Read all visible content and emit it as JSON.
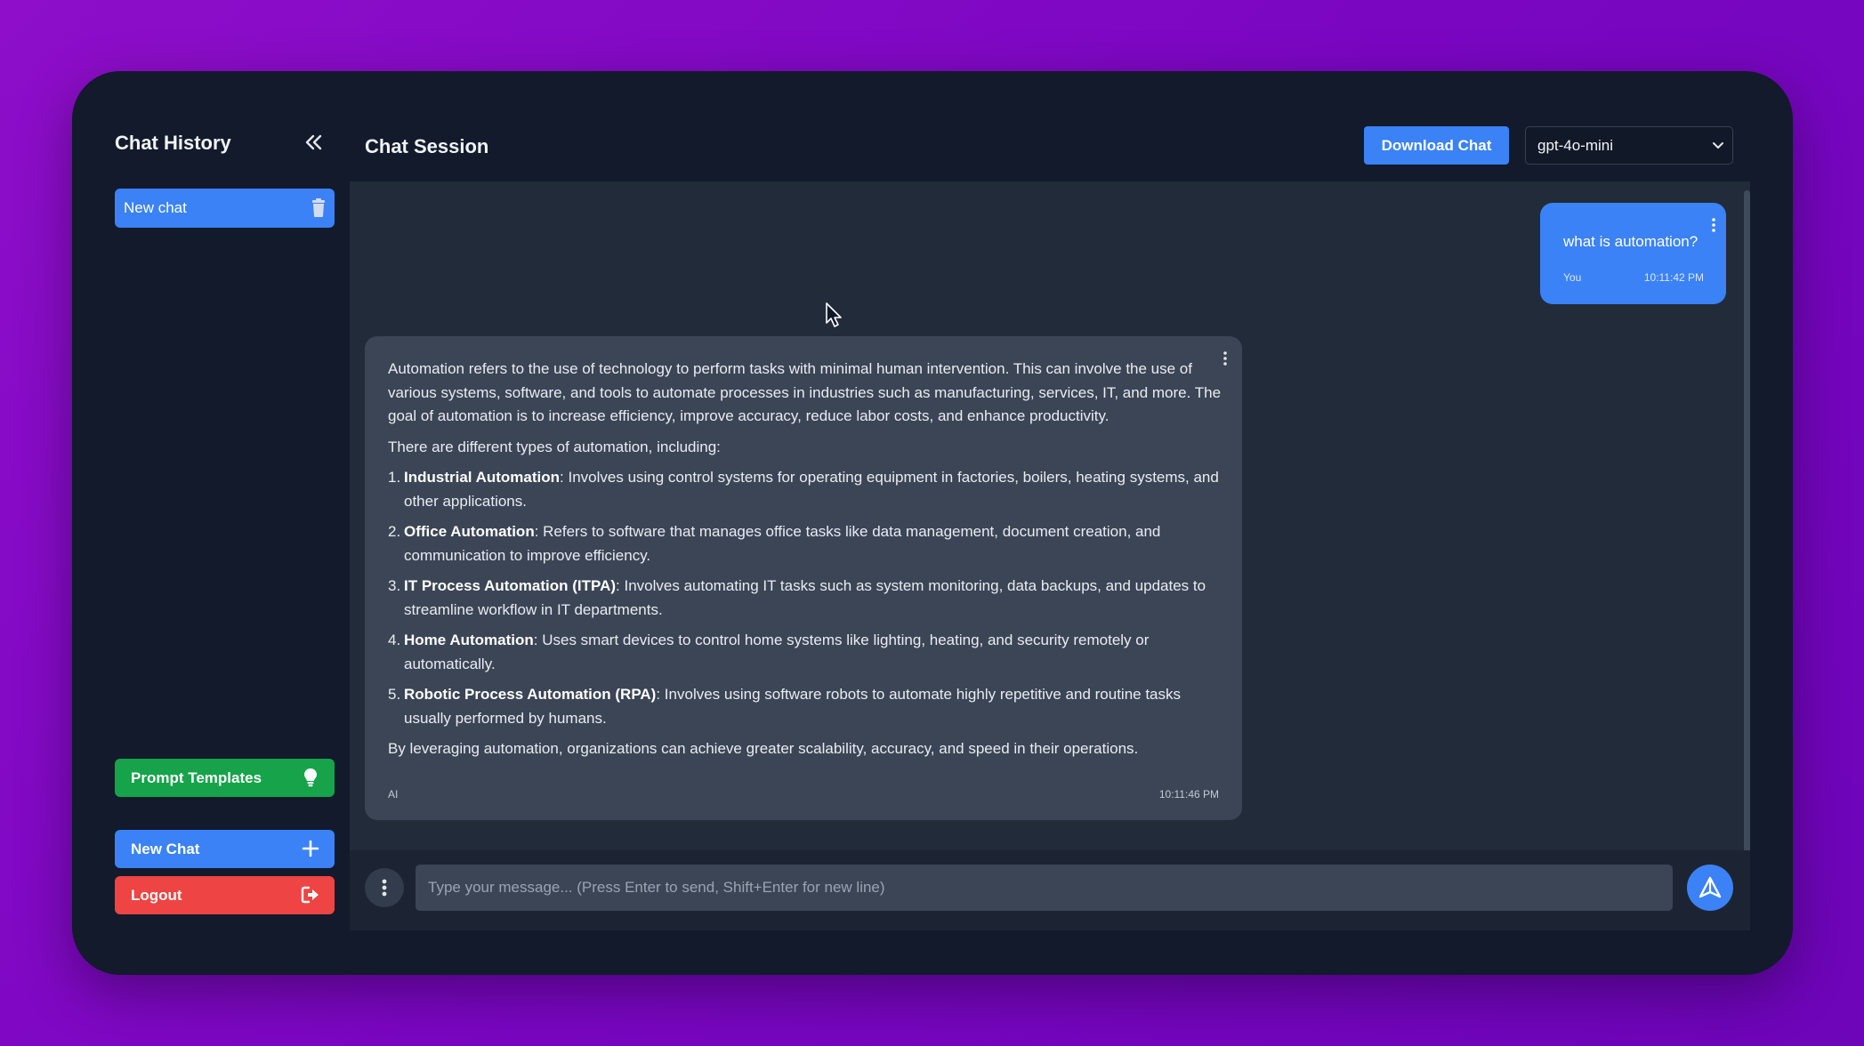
{
  "colors": {
    "background": "#8e0ec9",
    "window": "#121a2b",
    "primary": "#3b82f6",
    "success": "#16a34a",
    "danger": "#ef4444",
    "chat_area": "#222b3a",
    "ai_bubble": "#3c4555"
  },
  "sidebar": {
    "title": "Chat History",
    "collapse_icon": "double-chevron-left-icon",
    "history": [
      {
        "label": "New chat",
        "icon": "trash-icon"
      }
    ],
    "prompt_templates_label": "Prompt Templates",
    "prompt_templates_icon": "lightbulb-icon",
    "new_chat_label": "New Chat",
    "new_chat_icon": "plus-icon",
    "logout_label": "Logout",
    "logout_icon": "logout-icon"
  },
  "header": {
    "title": "Chat Session",
    "download_label": "Download Chat",
    "model_selected": "gpt-4o-mini"
  },
  "messages": {
    "user": {
      "text": "what is automation?",
      "sender": "You",
      "time": "10:11:42 PM"
    },
    "ai": {
      "intro": "Automation refers to the use of technology to perform tasks with minimal human intervention. This can involve the use of various systems, software, and tools to automate processes in industries such as manufacturing, services, IT, and more. The goal of automation is to increase efficiency, improve accuracy, reduce labor costs, and enhance productivity.",
      "types_heading": "There are different types of automation, including:",
      "items": [
        {
          "num": "1.",
          "title": "Industrial Automation",
          "desc": ": Involves using control systems for operating equipment in factories, boilers, heating systems, and other applications."
        },
        {
          "num": "2.",
          "title": "Office Automation",
          "desc": ": Refers to software that manages office tasks like data management, document creation, and communication to improve efficiency."
        },
        {
          "num": "3.",
          "title": "IT Process Automation (ITPA)",
          "desc": ": Involves automating IT tasks such as system monitoring, data backups, and updates to streamline workflow in IT departments."
        },
        {
          "num": "4.",
          "title": "Home Automation",
          "desc": ": Uses smart devices to control home systems like lighting, heating, and security remotely or automatically."
        },
        {
          "num": "5.",
          "title": "Robotic Process Automation (RPA)",
          "desc": ": Involves using software robots to automate highly repetitive and routine tasks usually performed by humans."
        }
      ],
      "conclusion": "By leveraging automation, organizations can achieve greater scalability, accuracy, and speed in their operations.",
      "sender": "AI",
      "time": "10:11:46 PM"
    }
  },
  "input": {
    "placeholder": "Type your message... (Press Enter to send, Shift+Enter for new line)",
    "menu_icon": "vertical-dots-icon",
    "send_icon": "send-icon"
  }
}
